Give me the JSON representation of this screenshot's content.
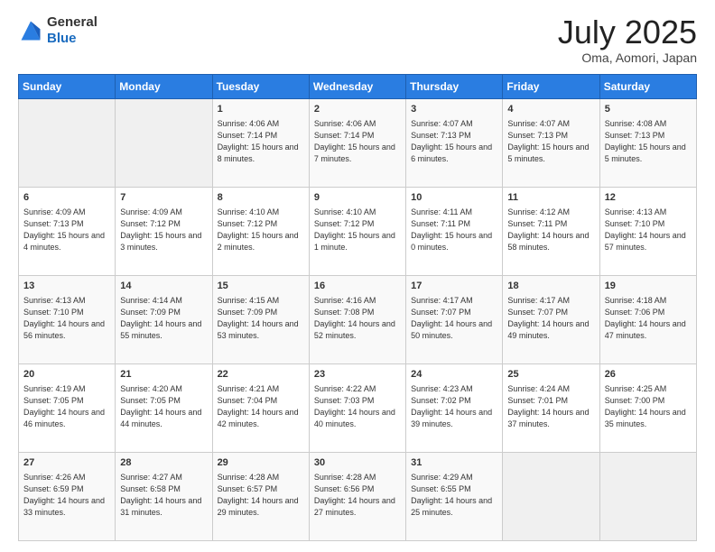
{
  "header": {
    "logo_general": "General",
    "logo_blue": "Blue",
    "title": "July 2025",
    "location": "Oma, Aomori, Japan"
  },
  "days_of_week": [
    "Sunday",
    "Monday",
    "Tuesday",
    "Wednesday",
    "Thursday",
    "Friday",
    "Saturday"
  ],
  "weeks": [
    [
      {
        "day": "",
        "info": ""
      },
      {
        "day": "",
        "info": ""
      },
      {
        "day": "1",
        "info": "Sunrise: 4:06 AM\nSunset: 7:14 PM\nDaylight: 15 hours and 8 minutes."
      },
      {
        "day": "2",
        "info": "Sunrise: 4:06 AM\nSunset: 7:14 PM\nDaylight: 15 hours and 7 minutes."
      },
      {
        "day": "3",
        "info": "Sunrise: 4:07 AM\nSunset: 7:13 PM\nDaylight: 15 hours and 6 minutes."
      },
      {
        "day": "4",
        "info": "Sunrise: 4:07 AM\nSunset: 7:13 PM\nDaylight: 15 hours and 5 minutes."
      },
      {
        "day": "5",
        "info": "Sunrise: 4:08 AM\nSunset: 7:13 PM\nDaylight: 15 hours and 5 minutes."
      }
    ],
    [
      {
        "day": "6",
        "info": "Sunrise: 4:09 AM\nSunset: 7:13 PM\nDaylight: 15 hours and 4 minutes."
      },
      {
        "day": "7",
        "info": "Sunrise: 4:09 AM\nSunset: 7:12 PM\nDaylight: 15 hours and 3 minutes."
      },
      {
        "day": "8",
        "info": "Sunrise: 4:10 AM\nSunset: 7:12 PM\nDaylight: 15 hours and 2 minutes."
      },
      {
        "day": "9",
        "info": "Sunrise: 4:10 AM\nSunset: 7:12 PM\nDaylight: 15 hours and 1 minute."
      },
      {
        "day": "10",
        "info": "Sunrise: 4:11 AM\nSunset: 7:11 PM\nDaylight: 15 hours and 0 minutes."
      },
      {
        "day": "11",
        "info": "Sunrise: 4:12 AM\nSunset: 7:11 PM\nDaylight: 14 hours and 58 minutes."
      },
      {
        "day": "12",
        "info": "Sunrise: 4:13 AM\nSunset: 7:10 PM\nDaylight: 14 hours and 57 minutes."
      }
    ],
    [
      {
        "day": "13",
        "info": "Sunrise: 4:13 AM\nSunset: 7:10 PM\nDaylight: 14 hours and 56 minutes."
      },
      {
        "day": "14",
        "info": "Sunrise: 4:14 AM\nSunset: 7:09 PM\nDaylight: 14 hours and 55 minutes."
      },
      {
        "day": "15",
        "info": "Sunrise: 4:15 AM\nSunset: 7:09 PM\nDaylight: 14 hours and 53 minutes."
      },
      {
        "day": "16",
        "info": "Sunrise: 4:16 AM\nSunset: 7:08 PM\nDaylight: 14 hours and 52 minutes."
      },
      {
        "day": "17",
        "info": "Sunrise: 4:17 AM\nSunset: 7:07 PM\nDaylight: 14 hours and 50 minutes."
      },
      {
        "day": "18",
        "info": "Sunrise: 4:17 AM\nSunset: 7:07 PM\nDaylight: 14 hours and 49 minutes."
      },
      {
        "day": "19",
        "info": "Sunrise: 4:18 AM\nSunset: 7:06 PM\nDaylight: 14 hours and 47 minutes."
      }
    ],
    [
      {
        "day": "20",
        "info": "Sunrise: 4:19 AM\nSunset: 7:05 PM\nDaylight: 14 hours and 46 minutes."
      },
      {
        "day": "21",
        "info": "Sunrise: 4:20 AM\nSunset: 7:05 PM\nDaylight: 14 hours and 44 minutes."
      },
      {
        "day": "22",
        "info": "Sunrise: 4:21 AM\nSunset: 7:04 PM\nDaylight: 14 hours and 42 minutes."
      },
      {
        "day": "23",
        "info": "Sunrise: 4:22 AM\nSunset: 7:03 PM\nDaylight: 14 hours and 40 minutes."
      },
      {
        "day": "24",
        "info": "Sunrise: 4:23 AM\nSunset: 7:02 PM\nDaylight: 14 hours and 39 minutes."
      },
      {
        "day": "25",
        "info": "Sunrise: 4:24 AM\nSunset: 7:01 PM\nDaylight: 14 hours and 37 minutes."
      },
      {
        "day": "26",
        "info": "Sunrise: 4:25 AM\nSunset: 7:00 PM\nDaylight: 14 hours and 35 minutes."
      }
    ],
    [
      {
        "day": "27",
        "info": "Sunrise: 4:26 AM\nSunset: 6:59 PM\nDaylight: 14 hours and 33 minutes."
      },
      {
        "day": "28",
        "info": "Sunrise: 4:27 AM\nSunset: 6:58 PM\nDaylight: 14 hours and 31 minutes."
      },
      {
        "day": "29",
        "info": "Sunrise: 4:28 AM\nSunset: 6:57 PM\nDaylight: 14 hours and 29 minutes."
      },
      {
        "day": "30",
        "info": "Sunrise: 4:28 AM\nSunset: 6:56 PM\nDaylight: 14 hours and 27 minutes."
      },
      {
        "day": "31",
        "info": "Sunrise: 4:29 AM\nSunset: 6:55 PM\nDaylight: 14 hours and 25 minutes."
      },
      {
        "day": "",
        "info": ""
      },
      {
        "day": "",
        "info": ""
      }
    ]
  ]
}
